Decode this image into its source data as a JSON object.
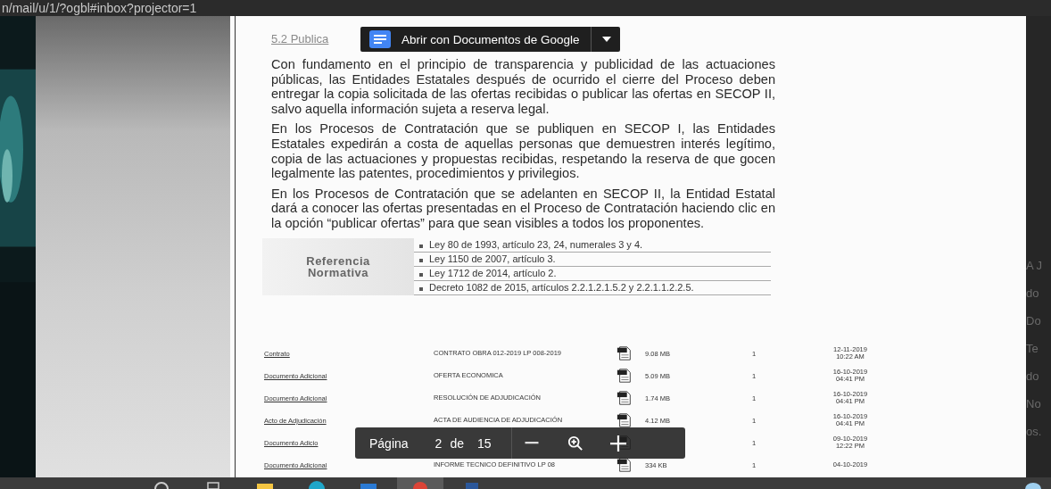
{
  "address_bar": {
    "url": "n/mail/u/1/?ogbl#inbox?projector=1"
  },
  "open_with_button": {
    "label": "Abrir con Documentos de Google"
  },
  "document": {
    "heading": "5.2 Publica",
    "paragraphs": [
      "Con fundamento en el principio de transparencia y publicidad de las actuaciones públicas, las Entidades Estatales después de ocurrido el cierre del Proceso deben entregar la copia solicitada de las ofertas recibidas o publicar las ofertas en SECOP II, salvo aquella información sujeta a reserva legal.",
      "En los Procesos de Contratación que se publiquen en SECOP I, las Entidades Estatales expedirán a costa de aquellas personas que demuestren interés legítimo, copia de las actuaciones y propuestas recibidas, respetando la reserva de que gocen legalmente las patentes, procedimientos y privilegios.",
      "En los Procesos de Contratación que se adelanten en SECOP II, la Entidad Estatal dará a conocer las ofertas presentadas en el Proceso de Contratación haciendo clic en la opción “publicar ofertas” para que sean visibles a todos los proponentes."
    ],
    "reference": {
      "label": [
        "Referencia",
        "Normativa"
      ],
      "items": [
        "Ley 80 de 1993, artículo 23, 24, numerales 3 y 4.",
        "Ley 1150 de 2007, artículo 3.",
        "Ley 1712 de 2014, artículo 2.",
        "Decreto 1082 de 2015, artículos 2.2.1.2.1.5.2 y 2.2.1.1.2.2.5."
      ]
    },
    "files": [
      {
        "name": "Contrato",
        "description": "CONTRATO OBRA 012-2019 LP 008-2019",
        "size": "9.08 MB",
        "count": "1",
        "date": "12-11-2019",
        "time": "10:22 AM"
      },
      {
        "name": "Documento Adicional",
        "description": "OFERTA ECONOMICA",
        "size": "5.09 MB",
        "count": "1",
        "date": "16-10-2019",
        "time": "04:41 PM"
      },
      {
        "name": "Documento Adicional",
        "description": "RESOLUCIÓN DE ADJUDICACIÓN",
        "size": "1.74 MB",
        "count": "1",
        "date": "16-10-2019",
        "time": "04:41 PM"
      },
      {
        "name": "Acto de Adjudicación",
        "description": "ACTA DE AUDIENCIA DE ADJUDICACIÓN",
        "size": "4.12 MB",
        "count": "1",
        "date": "16-10-2019",
        "time": "04:41 PM"
      },
      {
        "name": "Documento Adicio",
        "count": "1",
        "date": "09-10-2019",
        "time": "12:22 PM"
      },
      {
        "name": "Documento Adicional",
        "description": "INFORME TECNICO DEFINITIVO LP 08",
        "size": "334 KB",
        "count": "1",
        "date": "04-10-2019"
      }
    ]
  },
  "page_toolbar": {
    "label": "Página",
    "page": "2",
    "of": "de",
    "total": "15"
  },
  "background_fragments": [
    "A J",
    "do",
    "Do",
    "Te",
    "do",
    "No",
    "os."
  ],
  "taskbar": {
    "items": [
      {
        "kind": "search",
        "selected": false
      },
      {
        "kind": "tasks",
        "selected": false
      },
      {
        "kind": "folder",
        "selected": false
      },
      {
        "kind": "edge",
        "selected": false
      },
      {
        "kind": "mail",
        "selected": false
      },
      {
        "kind": "chrome",
        "selected": true
      },
      {
        "kind": "word",
        "selected": false
      }
    ]
  }
}
